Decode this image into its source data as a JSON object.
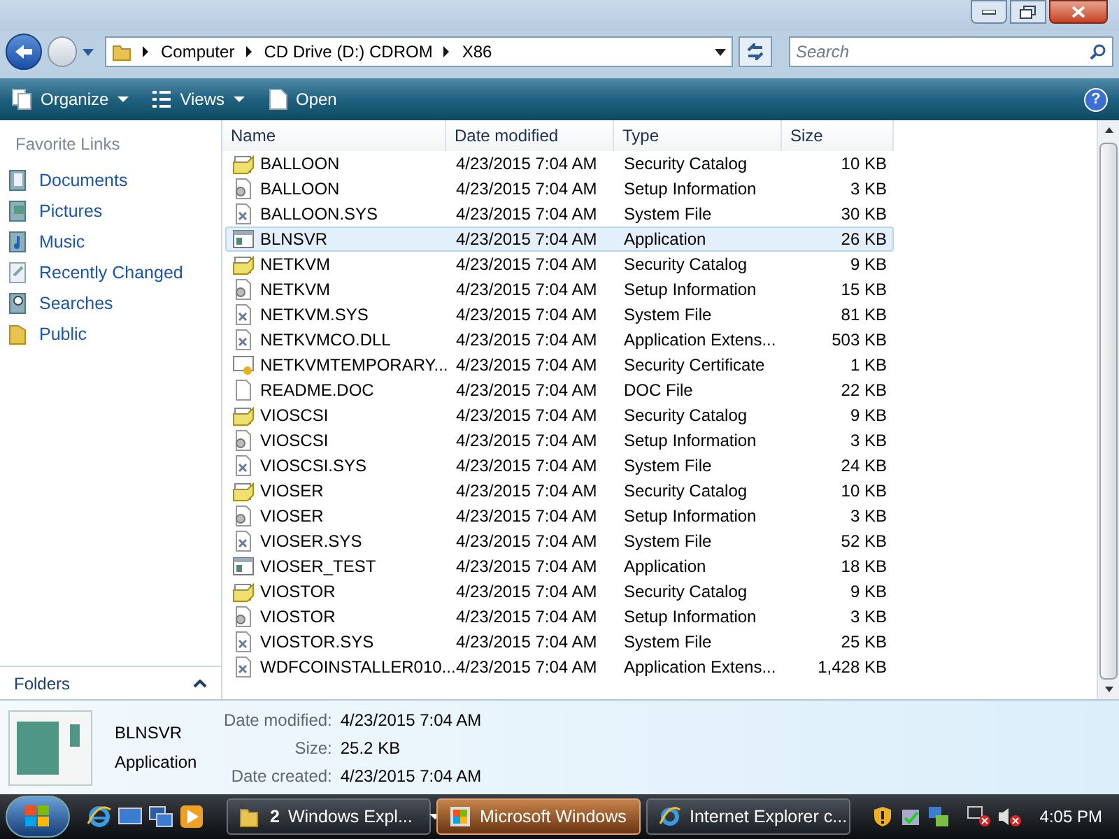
{
  "address": {
    "crumbs": [
      "Computer",
      "CD Drive (D:) CDROM",
      "X86"
    ]
  },
  "search": {
    "placeholder": "Search"
  },
  "toolbar": [
    "Organize",
    "Views",
    "Open"
  ],
  "help": "?",
  "sidebar": {
    "title": "Favorite Links",
    "items": [
      {
        "label": "Documents",
        "kind": "documents"
      },
      {
        "label": "Pictures",
        "kind": "pictures"
      },
      {
        "label": "Music",
        "kind": "music"
      },
      {
        "label": "Recently Changed",
        "kind": "recent"
      },
      {
        "label": "Searches",
        "kind": "searches"
      },
      {
        "label": "Public",
        "kind": "folder"
      }
    ],
    "folders": "Folders"
  },
  "table": {
    "columns": [
      "Name",
      "Date modified",
      "Type",
      "Size"
    ],
    "rows": [
      {
        "name": "BALLOON",
        "date": "4/23/2015 7:04 AM",
        "type": "Security Catalog",
        "size": "10 KB",
        "kind": "catalog",
        "selected": false
      },
      {
        "name": "BALLOON",
        "date": "4/23/2015 7:04 AM",
        "type": "Setup Information",
        "size": "3 KB",
        "kind": "setup",
        "selected": false
      },
      {
        "name": "BALLOON.SYS",
        "date": "4/23/2015 7:04 AM",
        "type": "System File",
        "size": "30 KB",
        "kind": "sys",
        "selected": false
      },
      {
        "name": "BLNSVR",
        "date": "4/23/2015 7:04 AM",
        "type": "Application",
        "size": "26 KB",
        "kind": "app",
        "selected": true
      },
      {
        "name": "NETKVM",
        "date": "4/23/2015 7:04 AM",
        "type": "Security Catalog",
        "size": "9 KB",
        "kind": "catalog",
        "selected": false
      },
      {
        "name": "NETKVM",
        "date": "4/23/2015 7:04 AM",
        "type": "Setup Information",
        "size": "15 KB",
        "kind": "setup",
        "selected": false
      },
      {
        "name": "NETKVM.SYS",
        "date": "4/23/2015 7:04 AM",
        "type": "System File",
        "size": "81 KB",
        "kind": "sys",
        "selected": false
      },
      {
        "name": "NETKVMCO.DLL",
        "date": "4/23/2015 7:04 AM",
        "type": "Application Extens...",
        "size": "503 KB",
        "kind": "sys",
        "selected": false
      },
      {
        "name": "NETKVMTEMPORARY...",
        "date": "4/23/2015 7:04 AM",
        "type": "Security Certificate",
        "size": "1 KB",
        "kind": "cert",
        "selected": false
      },
      {
        "name": "README.DOC",
        "date": "4/23/2015 7:04 AM",
        "type": "DOC File",
        "size": "22 KB",
        "kind": "doc",
        "selected": false
      },
      {
        "name": "VIOSCSI",
        "date": "4/23/2015 7:04 AM",
        "type": "Security Catalog",
        "size": "9 KB",
        "kind": "catalog",
        "selected": false
      },
      {
        "name": "VIOSCSI",
        "date": "4/23/2015 7:04 AM",
        "type": "Setup Information",
        "size": "3 KB",
        "kind": "setup",
        "selected": false
      },
      {
        "name": "VIOSCSI.SYS",
        "date": "4/23/2015 7:04 AM",
        "type": "System File",
        "size": "24 KB",
        "kind": "sys",
        "selected": false
      },
      {
        "name": "VIOSER",
        "date": "4/23/2015 7:04 AM",
        "type": "Security Catalog",
        "size": "10 KB",
        "kind": "catalog",
        "selected": false
      },
      {
        "name": "VIOSER",
        "date": "4/23/2015 7:04 AM",
        "type": "Setup Information",
        "size": "3 KB",
        "kind": "setup",
        "selected": false
      },
      {
        "name": "VIOSER.SYS",
        "date": "4/23/2015 7:04 AM",
        "type": "System File",
        "size": "52 KB",
        "kind": "sys",
        "selected": false
      },
      {
        "name": "VIOSER_TEST",
        "date": "4/23/2015 7:04 AM",
        "type": "Application",
        "size": "18 KB",
        "kind": "app",
        "selected": false
      },
      {
        "name": "VIOSTOR",
        "date": "4/23/2015 7:04 AM",
        "type": "Security Catalog",
        "size": "9 KB",
        "kind": "catalog",
        "selected": false
      },
      {
        "name": "VIOSTOR",
        "date": "4/23/2015 7:04 AM",
        "type": "Setup Information",
        "size": "3 KB",
        "kind": "setup",
        "selected": false
      },
      {
        "name": "VIOSTOR.SYS",
        "date": "4/23/2015 7:04 AM",
        "type": "System File",
        "size": "25 KB",
        "kind": "sys",
        "selected": false
      },
      {
        "name": "WDFCOINSTALLER010...",
        "date": "4/23/2015 7:04 AM",
        "type": "Application Extens...",
        "size": "1,428 KB",
        "kind": "sys",
        "selected": false
      }
    ]
  },
  "details": {
    "name": "BLNSVR",
    "type": "Application",
    "fields": [
      {
        "label": "Date modified:",
        "value": "4/23/2015 7:04 AM"
      },
      {
        "label": "Size:",
        "value": "25.2 KB"
      },
      {
        "label": "Date created:",
        "value": "4/23/2015 7:04 AM"
      }
    ]
  },
  "taskbar": {
    "buttons": [
      {
        "count": "2",
        "label": "Windows Expl...",
        "kind": "folder",
        "selected": false
      },
      {
        "label": "Microsoft Windows",
        "kind": "windows",
        "selected": true
      },
      {
        "label": "Internet Explorer c...",
        "kind": "ie",
        "selected": false
      }
    ],
    "clock": "4:05 PM"
  }
}
